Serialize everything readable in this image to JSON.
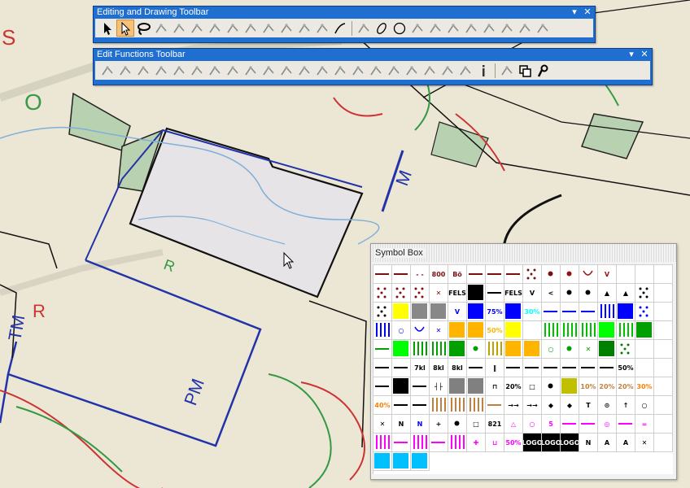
{
  "drawing_toolbar": {
    "title": "Editing and Drawing Toolbar",
    "menu_glyph": "▾",
    "close_glyph": "✕",
    "tools": [
      "arrow-select-icon",
      "node-select-icon",
      "lasso-icon",
      "node-add-icon",
      "node-move-icon",
      "node-snap-icon",
      "node-delete-icon",
      "pen-icon",
      "rotate-icon",
      "cut-icon",
      "cut-scissors-icon",
      "split-icon",
      "join-icon",
      "curve-icon",
      "polyline-icon",
      "ellipse-icon",
      "circle-icon",
      "angle-icon",
      "rhombus-icon",
      "stairs-icon",
      "step-line-icon",
      "spline-icon",
      "dashed-line-icon",
      "dotted-line-icon",
      "diagonal-line-icon"
    ]
  },
  "edit_toolbar": {
    "title": "Edit Functions Toolbar",
    "menu_glyph": "▾",
    "close_glyph": "✕",
    "tools": [
      "delete-cross-icon",
      "reverse-icon",
      "align-left-icon",
      "align-right-icon",
      "parallel-lines-icon",
      "text-lines-icon",
      "crop-icon",
      "hatch-icon",
      "wave-lines-icon",
      "stair-step-icon",
      "spiral-icon",
      "cross-hatch-icon",
      "fork-icon",
      "branch-icon",
      "merge-icon",
      "eraser-icon",
      "scissors-icon",
      "extend-icon",
      "trim-icon",
      "align-bottom-icon",
      "fill-lines-icon",
      "info-icon",
      "text-style-icon",
      "copy-icon",
      "anchor-icon"
    ]
  },
  "symbol_box": {
    "title": "Symbol Box",
    "cells": [
      {
        "kind": "line",
        "color": "#7a1010"
      },
      {
        "kind": "line",
        "color": "#7a1010"
      },
      {
        "kind": "text",
        "text": "- -",
        "color": "#7a1010"
      },
      {
        "kind": "text",
        "text": "800",
        "color": "#7a1010"
      },
      {
        "kind": "text",
        "text": "Bö",
        "color": "#7a1010"
      },
      {
        "kind": "line",
        "color": "#7a1010"
      },
      {
        "kind": "line",
        "color": "#7a1010"
      },
      {
        "kind": "line",
        "color": "#7a1010"
      },
      {
        "kind": "dots",
        "color": "#7a1010"
      },
      {
        "kind": "dot",
        "color": "#7a1010"
      },
      {
        "kind": "dot",
        "color": "#9a1010"
      },
      {
        "kind": "arc",
        "color": "#9a1010"
      },
      {
        "kind": "text",
        "text": "V",
        "color": "#9a1010"
      },
      {
        "kind": "blank",
        "color": "#ffffff"
      },
      {
        "kind": "blank",
        "color": "#ffffff"
      },
      {
        "kind": "blank",
        "color": "#ffffff"
      },
      {
        "kind": "dots",
        "color": "#7a1010"
      },
      {
        "kind": "dots",
        "color": "#7a1010"
      },
      {
        "kind": "dots",
        "color": "#7a1010"
      },
      {
        "kind": "text",
        "text": "✕",
        "color": "#7a1010"
      },
      {
        "kind": "text",
        "text": "FELS",
        "color": "#000000"
      },
      {
        "kind": "fill",
        "color": "#000000"
      },
      {
        "kind": "line",
        "color": "#000000"
      },
      {
        "kind": "text",
        "text": "FELS",
        "color": "#000000"
      },
      {
        "kind": "text",
        "text": "V",
        "color": "#000000"
      },
      {
        "kind": "text",
        "text": "<",
        "color": "#000000"
      },
      {
        "kind": "dot",
        "color": "#000000"
      },
      {
        "kind": "dot",
        "color": "#000000"
      },
      {
        "kind": "text",
        "text": "▲",
        "color": "#000000"
      },
      {
        "kind": "text",
        "text": "▲",
        "color": "#000000"
      },
      {
        "kind": "dots",
        "color": "#000000"
      },
      {
        "kind": "blank",
        "color": "#ffffff"
      },
      {
        "kind": "dots",
        "color": "#000000"
      },
      {
        "kind": "fill",
        "color": "#ffff00"
      },
      {
        "kind": "fill",
        "color": "#888888"
      },
      {
        "kind": "fill",
        "color": "#888888"
      },
      {
        "kind": "text",
        "text": "V",
        "color": "#0000ff"
      },
      {
        "kind": "fill",
        "color": "#0000ff"
      },
      {
        "kind": "text",
        "text": "75%",
        "color": "#0000ff"
      },
      {
        "kind": "fill",
        "color": "#0000ff"
      },
      {
        "kind": "text",
        "text": "30%",
        "color": "#00ffff"
      },
      {
        "kind": "line",
        "color": "#0000ff"
      },
      {
        "kind": "line",
        "color": "#0000ff"
      },
      {
        "kind": "line",
        "color": "#0000ff"
      },
      {
        "kind": "stripes",
        "color": "#0000ff"
      },
      {
        "kind": "fill",
        "color": "#0000ff"
      },
      {
        "kind": "dots",
        "color": "#0000ff"
      },
      {
        "kind": "blank",
        "color": "#ffffff"
      },
      {
        "kind": "stripes",
        "color": "#0000ff"
      },
      {
        "kind": "text",
        "text": "○",
        "color": "#0000ff"
      },
      {
        "kind": "arc",
        "color": "#0000ff"
      },
      {
        "kind": "text",
        "text": "✕",
        "color": "#0000ff"
      },
      {
        "kind": "fill",
        "color": "#ffb400"
      },
      {
        "kind": "fill",
        "color": "#ffb400"
      },
      {
        "kind": "text",
        "text": "50%",
        "color": "#ffb400"
      },
      {
        "kind": "fill",
        "color": "#ffff00"
      },
      {
        "kind": "blank",
        "color": "#ffffff"
      },
      {
        "kind": "stripes",
        "color": "#00c000"
      },
      {
        "kind": "stripes",
        "color": "#00c000"
      },
      {
        "kind": "stripes",
        "color": "#00c000"
      },
      {
        "kind": "fill",
        "color": "#00ff00"
      },
      {
        "kind": "stripes",
        "color": "#00c000"
      },
      {
        "kind": "fill",
        "color": "#00a000"
      },
      {
        "kind": "blank",
        "color": "#ffffff"
      },
      {
        "kind": "line",
        "color": "#00a000"
      },
      {
        "kind": "fill",
        "color": "#00ff00"
      },
      {
        "kind": "stripes",
        "color": "#00a000"
      },
      {
        "kind": "stripes",
        "color": "#00a000"
      },
      {
        "kind": "fill",
        "color": "#00a000"
      },
      {
        "kind": "dot",
        "color": "#00a000"
      },
      {
        "kind": "stripes",
        "color": "#c0a000"
      },
      {
        "kind": "fill",
        "color": "#ffb400"
      },
      {
        "kind": "fill",
        "color": "#ffb400"
      },
      {
        "kind": "text",
        "text": "○",
        "color": "#00a000"
      },
      {
        "kind": "dot",
        "color": "#00a000"
      },
      {
        "kind": "text",
        "text": "✕",
        "color": "#00a000"
      },
      {
        "kind": "fill",
        "color": "#008000"
      },
      {
        "kind": "dots",
        "color": "#008000"
      },
      {
        "kind": "blank",
        "color": "#ffffff"
      },
      {
        "kind": "blank",
        "color": "#ffffff"
      },
      {
        "kind": "line",
        "color": "#000000"
      },
      {
        "kind": "line",
        "color": "#000000"
      },
      {
        "kind": "text",
        "text": "7kl",
        "color": "#000000"
      },
      {
        "kind": "text",
        "text": "8kl",
        "color": "#000000"
      },
      {
        "kind": "text",
        "text": "8kl",
        "color": "#000000"
      },
      {
        "kind": "line",
        "color": "#000000"
      },
      {
        "kind": "text",
        "text": "‖",
        "color": "#000000"
      },
      {
        "kind": "line",
        "color": "#000000"
      },
      {
        "kind": "line",
        "color": "#000000"
      },
      {
        "kind": "line",
        "color": "#000000"
      },
      {
        "kind": "line",
        "color": "#000000"
      },
      {
        "kind": "line",
        "color": "#000000"
      },
      {
        "kind": "line",
        "color": "#000000"
      },
      {
        "kind": "text",
        "text": "50%",
        "color": "#000000"
      },
      {
        "kind": "blank",
        "color": "#ffffff"
      },
      {
        "kind": "blank",
        "color": "#ffffff"
      },
      {
        "kind": "line",
        "color": "#000000"
      },
      {
        "kind": "fill",
        "color": "#000000"
      },
      {
        "kind": "line",
        "color": "#000000"
      },
      {
        "kind": "text",
        "text": "┤├",
        "color": "#000000"
      },
      {
        "kind": "fill",
        "color": "#808080"
      },
      {
        "kind": "fill",
        "color": "#808080"
      },
      {
        "kind": "text",
        "text": "⊓",
        "color": "#000000"
      },
      {
        "kind": "text",
        "text": "20%",
        "color": "#000000"
      },
      {
        "kind": "text",
        "text": "□",
        "color": "#000000"
      },
      {
        "kind": "dot",
        "color": "#000000"
      },
      {
        "kind": "fill",
        "color": "#c0c000"
      },
      {
        "kind": "text",
        "text": "10%",
        "color": "#c08040"
      },
      {
        "kind": "text",
        "text": "20%",
        "color": "#c08040"
      },
      {
        "kind": "text",
        "text": "20%",
        "color": "#c08040"
      },
      {
        "kind": "text",
        "text": "30%",
        "color": "#ff8000"
      },
      {
        "kind": "blank",
        "color": "#ffffff"
      },
      {
        "kind": "text",
        "text": "40%",
        "color": "#ff8000"
      },
      {
        "kind": "line",
        "color": "#000000"
      },
      {
        "kind": "line",
        "color": "#000000"
      },
      {
        "kind": "stripes",
        "color": "#c08040"
      },
      {
        "kind": "stripes",
        "color": "#c08040"
      },
      {
        "kind": "stripes",
        "color": "#c08040"
      },
      {
        "kind": "line",
        "color": "#c08040"
      },
      {
        "kind": "text",
        "text": "→→",
        "color": "#000000"
      },
      {
        "kind": "text",
        "text": "→→",
        "color": "#000000"
      },
      {
        "kind": "text",
        "text": "◆",
        "color": "#000000"
      },
      {
        "kind": "text",
        "text": "◆",
        "color": "#000000"
      },
      {
        "kind": "text",
        "text": "T",
        "color": "#000000"
      },
      {
        "kind": "text",
        "text": "⊙",
        "color": "#000000"
      },
      {
        "kind": "text",
        "text": "↑",
        "color": "#000000"
      },
      {
        "kind": "text",
        "text": "○",
        "color": "#000000"
      },
      {
        "kind": "blank",
        "color": "#ffffff"
      },
      {
        "kind": "text",
        "text": "✕",
        "color": "#000000"
      },
      {
        "kind": "text",
        "text": "N",
        "color": "#000000"
      },
      {
        "kind": "text",
        "text": "N",
        "color": "#0000ff"
      },
      {
        "kind": "text",
        "text": "+",
        "color": "#000000"
      },
      {
        "kind": "dot",
        "color": "#000000"
      },
      {
        "kind": "text",
        "text": "□",
        "color": "#000000"
      },
      {
        "kind": "text",
        "text": "821",
        "color": "#000000"
      },
      {
        "kind": "text",
        "text": "△",
        "color": "#ff00ff"
      },
      {
        "kind": "text",
        "text": "○",
        "color": "#ff00ff"
      },
      {
        "kind": "text",
        "text": "5",
        "color": "#ff00ff"
      },
      {
        "kind": "line",
        "color": "#ff00ff"
      },
      {
        "kind": "line",
        "color": "#ff00ff"
      },
      {
        "kind": "text",
        "text": "◎",
        "color": "#ff00ff"
      },
      {
        "kind": "line",
        "color": "#ff00ff"
      },
      {
        "kind": "text",
        "text": "=",
        "color": "#ff00ff"
      },
      {
        "kind": "blank",
        "color": "#ffffff"
      },
      {
        "kind": "stripes",
        "color": "#ff00ff"
      },
      {
        "kind": "line",
        "color": "#ff00ff"
      },
      {
        "kind": "stripes",
        "color": "#ff00ff"
      },
      {
        "kind": "line",
        "color": "#ff00ff"
      },
      {
        "kind": "stripes",
        "color": "#ff00ff"
      },
      {
        "kind": "text",
        "text": "✚",
        "color": "#ff00ff"
      },
      {
        "kind": "text",
        "text": "⊔",
        "color": "#ff00ff"
      },
      {
        "kind": "text",
        "text": "50%",
        "color": "#ff00ff"
      },
      {
        "kind": "text",
        "text": "LOGO",
        "color": "#ffffff"
      },
      {
        "kind": "text",
        "text": "LOGO",
        "color": "#ffffff"
      },
      {
        "kind": "text",
        "text": "LOGO",
        "color": "#ffffff"
      },
      {
        "kind": "text",
        "text": "N",
        "color": "#000000"
      },
      {
        "kind": "text",
        "text": "A",
        "color": "#000000"
      },
      {
        "kind": "text",
        "text": "A",
        "color": "#000000"
      },
      {
        "kind": "text",
        "text": "✕",
        "color": "#000000"
      },
      {
        "kind": "blank",
        "color": "#ffffff"
      },
      {
        "kind": "fill",
        "color": "#00c0ff"
      },
      {
        "kind": "fill",
        "color": "#00c0ff"
      },
      {
        "kind": "fill",
        "color": "#00c0ff"
      }
    ]
  }
}
